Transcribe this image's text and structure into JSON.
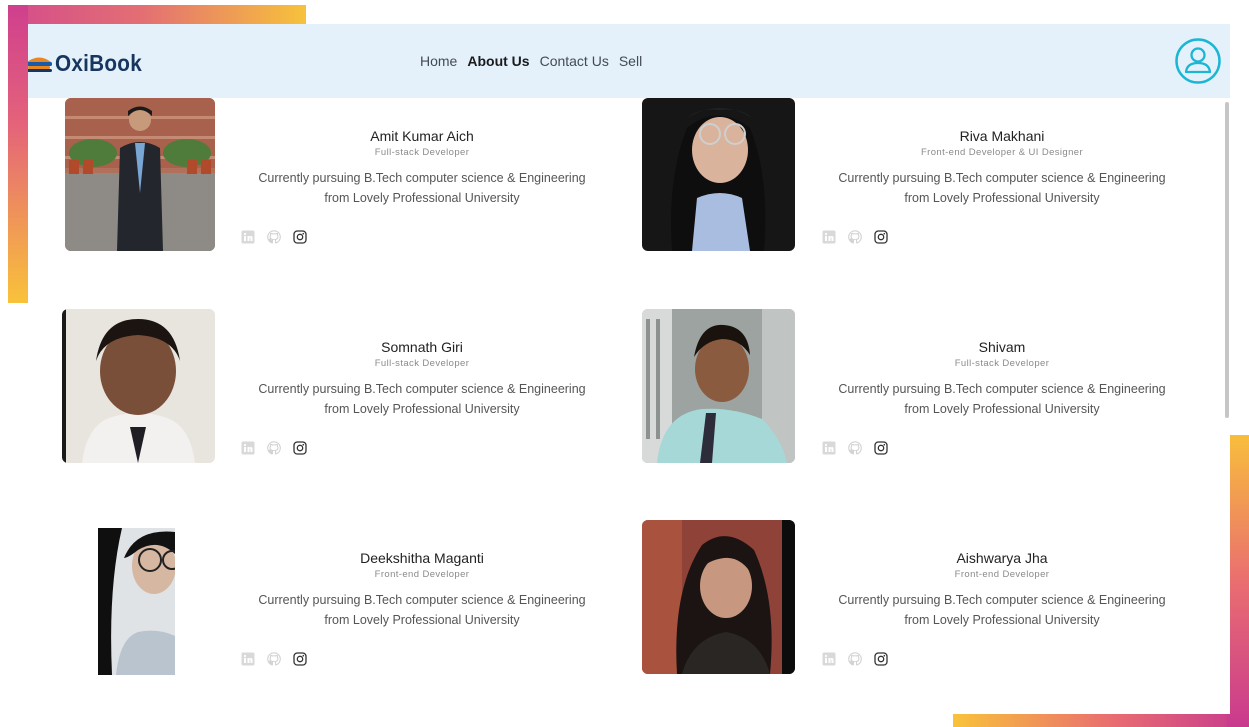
{
  "app": {
    "logo_text": "OxiBook"
  },
  "nav": {
    "links": [
      "Home",
      "About Us",
      "Contact Us",
      "Sell"
    ],
    "active": "About Us"
  },
  "team": [
    {
      "name": "Amit Kumar Aich",
      "role": "Full-stack Developer",
      "desc_line1": "Currently pursuing B.Tech computer science & Engineering",
      "desc_line2": "from Lovely Professional University"
    },
    {
      "name": "Riva Makhani",
      "role": "Front-end Developer & UI Designer",
      "desc_line1": "Currently pursuing B.Tech computer science & Engineering",
      "desc_line2": "from Lovely Professional University"
    },
    {
      "name": "Somnath Giri",
      "role": "Full-stack Developer",
      "desc_line1": "Currently pursuing B.Tech computer science & Engineering",
      "desc_line2": "from Lovely Professional University"
    },
    {
      "name": "Shivam",
      "role": "Full-stack Developer",
      "desc_line1": "Currently pursuing B.Tech computer science & Engineering",
      "desc_line2": "from Lovely Professional University"
    },
    {
      "name": "Deekshitha Maganti",
      "role": "Front-end Developer",
      "desc_line1": "Currently pursuing B.Tech computer science & Engineering",
      "desc_line2": "from Lovely Professional University"
    },
    {
      "name": "Aishwarya Jha",
      "role": "Front-end Developer",
      "desc_line1": "Currently pursuing B.Tech computer science & Engineering",
      "desc_line2": "from Lovely Professional University"
    }
  ],
  "social_icons": [
    "linkedin-icon",
    "github-icon",
    "instagram-icon"
  ],
  "colors": {
    "navbar_bg": "#e4f1fb",
    "logo_text": "#16365f",
    "avatar_accent": "#1ab6d3",
    "frame_pink": "#d44c8c",
    "frame_yellow": "#f7c23b"
  }
}
